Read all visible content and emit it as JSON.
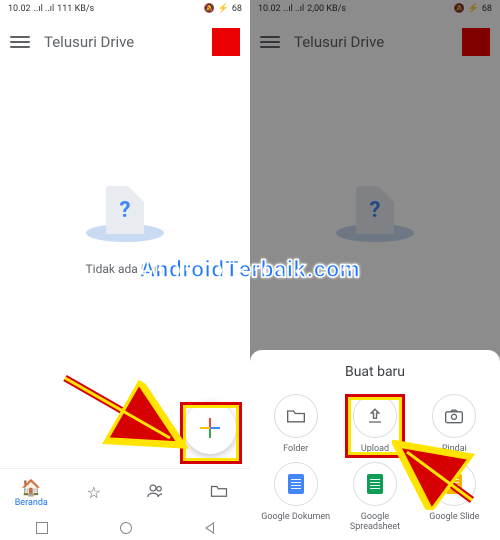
{
  "watermark": "AndroidTerbaik.com",
  "left": {
    "status": {
      "time": "10.02",
      "signal": "..ıl ..ıl",
      "net": "111 KB/s",
      "battery": "68"
    },
    "search_placeholder": "Telusuri Drive",
    "empty_question": "?",
    "empty_text": "Tidak ada item",
    "nav": {
      "home_label": "Beranda",
      "home_icon": "⌂",
      "star_icon": "☆",
      "shared_icon": "👥",
      "files_icon": "▭"
    }
  },
  "right": {
    "status": {
      "time": "10.02",
      "signal": "..ıl ..ıl",
      "net": "2,00 KB/s",
      "battery": "68"
    },
    "search_placeholder": "Telusuri Drive",
    "sheet_title": "Buat baru",
    "items": {
      "folder": {
        "label": "Folder",
        "icon": "▭"
      },
      "upload": {
        "label": "Upload",
        "icon": "⤴"
      },
      "scan": {
        "label": "Pindai",
        "icon": "◉"
      },
      "docs": {
        "label": "Google Dokumen"
      },
      "sheets": {
        "label": "Google Spreadsheet"
      },
      "slides": {
        "label": "Google Slide"
      }
    }
  }
}
